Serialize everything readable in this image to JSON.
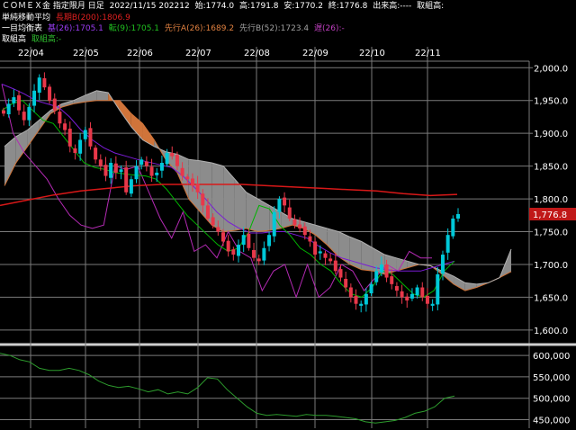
{
  "header": {
    "line1": {
      "symbol": "ＣＯＭＥＸ金 指定限月 日足",
      "date": "2022/11/15 202212",
      "open": "始:1774.0",
      "high": "高:1791.8",
      "low": "安:1770.2",
      "close": "終:1776.8",
      "volume": "出来高:----",
      "oi": "取組高:"
    },
    "line2": {
      "label": "単純移動平均",
      "ma200": "長期B(200):1806.9"
    },
    "line3": {
      "label": "一目均衡表",
      "kijun": "基(26):1705.1",
      "tenkan": "転(9):1705.1",
      "senkouA": "先行A(26):1689.2",
      "senkouB": "先行B(52):1723.4",
      "chikou": "遅(26):-"
    },
    "line4": {
      "label": "取組高",
      "oi": "取組高:-"
    },
    "colors": {
      "background": "#000000",
      "grid": "#7a7a7a",
      "up": "#00c8d8",
      "down": "#e8384a",
      "ma200": "#d81818",
      "tenkan": "#00b400",
      "kijun": "#7a1cd6",
      "chikou": "#b42ab4",
      "cloud_bull": "#d0743a",
      "cloud_bear": "#8c8c8c",
      "oi_line": "#2d9c2d",
      "price_tag_bg": "#c01818"
    }
  },
  "chart_data": [
    {
      "type": "candlestick",
      "x_labels": [
        "22/04",
        "22/05",
        "22/06",
        "22/07",
        "22/08",
        "22/09",
        "22/10",
        "22/11"
      ],
      "y_ticks": [
        "2,000.0",
        "1,950.0",
        "1,900.0",
        "1,850.0",
        "1,800.0",
        "1,750.0",
        "1,700.0",
        "1,650.0",
        "1,600.0"
      ],
      "y_values": [
        2000,
        1950,
        1900,
        1850,
        1800,
        1750,
        1700,
        1650,
        1600
      ],
      "ylim": [
        1582,
        2010
      ],
      "last_price_label": "1,776.8",
      "last_price": 1776.8,
      "close_path": [
        1930,
        1945,
        1955,
        1935,
        1920,
        1940,
        1965,
        1985,
        1970,
        1950,
        1935,
        1915,
        1905,
        1880,
        1870,
        1890,
        1905,
        1880,
        1860,
        1850,
        1835,
        1855,
        1840,
        1845,
        1810,
        1830,
        1850,
        1860,
        1850,
        1835,
        1840,
        1855,
        1870,
        1865,
        1850,
        1835,
        1830,
        1820,
        1810,
        1790,
        1770,
        1760,
        1750,
        1735,
        1720,
        1715,
        1730,
        1745,
        1725,
        1710,
        1705,
        1725,
        1745,
        1780,
        1800,
        1790,
        1770,
        1760,
        1755,
        1745,
        1735,
        1715,
        1720,
        1710,
        1705,
        1690,
        1680,
        1665,
        1650,
        1640,
        1640,
        1655,
        1670,
        1690,
        1700,
        1680,
        1670,
        1660,
        1650,
        1645,
        1655,
        1665,
        1650,
        1640,
        1640,
        1685,
        1715,
        1745,
        1770,
        1776.8
      ],
      "ma200_path": [
        1790,
        1798,
        1806,
        1812,
        1816,
        1820,
        1822,
        1822,
        1822,
        1822,
        1820,
        1818,
        1816,
        1814,
        1812,
        1808,
        1805,
        1806.9
      ],
      "tenkan_path": [
        1935,
        1945,
        1950,
        1935,
        1920,
        1915,
        1895,
        1875,
        1855,
        1848,
        1845,
        1840,
        1838,
        1836,
        1835,
        1830,
        1815,
        1795,
        1775,
        1760,
        1745,
        1730,
        1720,
        1725,
        1750,
        1790,
        1785,
        1760,
        1745,
        1725,
        1715,
        1700,
        1690,
        1670,
        1655,
        1650,
        1665,
        1690,
        1685,
        1670,
        1655,
        1650,
        1660,
        1690,
        1705.1
      ],
      "kijun_path": [
        1975,
        1968,
        1960,
        1950,
        1945,
        1940,
        1925,
        1905,
        1890,
        1878,
        1870,
        1865,
        1860,
        1856,
        1852,
        1848,
        1835,
        1818,
        1800,
        1780,
        1765,
        1755,
        1748,
        1748,
        1750,
        1750,
        1745,
        1740,
        1728,
        1718,
        1710,
        1705,
        1700,
        1695,
        1692,
        1690,
        1690,
        1690,
        1695,
        1700,
        1705.1
      ],
      "chikou_path": [
        1975,
        1900,
        1870,
        1850,
        1830,
        1800,
        1775,
        1760,
        1755,
        1760,
        1850,
        1845,
        1850,
        1810,
        1770,
        1740,
        1780,
        1720,
        1730,
        1710,
        1750,
        1720,
        1710,
        1660,
        1690,
        1700,
        1650,
        1700,
        1650,
        1665,
        1700,
        1690,
        1660,
        1680,
        1700,
        1690,
        1720,
        1710,
        1710
      ],
      "senkouA_path": [
        1820,
        1855,
        1880,
        1905,
        1930,
        1940,
        1945,
        1948,
        1950,
        1950,
        1950,
        1930,
        1915,
        1890,
        1860,
        1840,
        1800,
        1780,
        1760,
        1750,
        1752,
        1755,
        1750,
        1752,
        1755,
        1760,
        1755,
        1745,
        1730,
        1712,
        1700,
        1692,
        1690,
        1685,
        1690,
        1695,
        1700,
        1698,
        1685,
        1670,
        1660,
        1665,
        1672,
        1680,
        1689.2
      ],
      "senkouB_path": [
        1880,
        1895,
        1905,
        1920,
        1935,
        1945,
        1950,
        1958,
        1965,
        1962,
        1935,
        1910,
        1890,
        1880,
        1872,
        1868,
        1860,
        1858,
        1855,
        1850,
        1830,
        1810,
        1800,
        1790,
        1780,
        1770,
        1765,
        1760,
        1755,
        1750,
        1742,
        1735,
        1725,
        1715,
        1710,
        1705,
        1700,
        1698,
        1690,
        1682,
        1672,
        1670,
        1672,
        1680,
        1723.4
      ]
    },
    {
      "type": "line",
      "name": "取組高",
      "y_ticks": [
        "600,000",
        "550,000",
        "500,000",
        "450,000"
      ],
      "y_values": [
        600000,
        550000,
        500000,
        450000
      ],
      "ylim": [
        430000,
        615000
      ],
      "values": [
        605000,
        600000,
        590000,
        585000,
        570000,
        565000,
        565000,
        570000,
        565000,
        555000,
        540000,
        530000,
        525000,
        528000,
        522000,
        515000,
        520000,
        510000,
        515000,
        510000,
        525000,
        548000,
        545000,
        520000,
        500000,
        480000,
        465000,
        460000,
        462000,
        460000,
        458000,
        462000,
        460000,
        460000,
        458000,
        455000,
        452000,
        445000,
        442000,
        445000,
        448000,
        455000,
        465000,
        470000,
        480000,
        500000,
        505000
      ]
    }
  ]
}
